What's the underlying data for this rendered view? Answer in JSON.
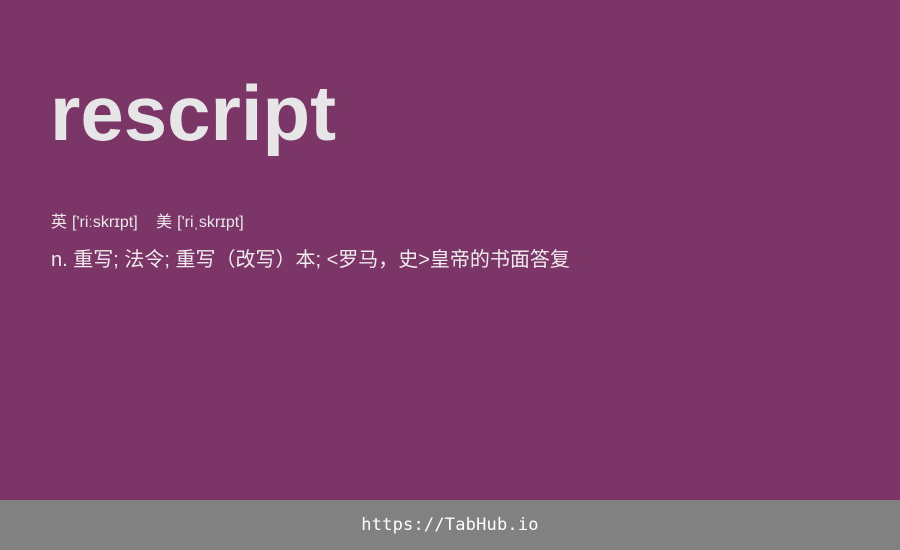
{
  "entry": {
    "word": "rescript",
    "phonetics": [
      {
        "region": "英",
        "ipa": "['riːskrɪpt]"
      },
      {
        "region": "美",
        "ipa": "['riˌskrɪpt]"
      }
    ],
    "definition": "n. 重写; 法令; 重写（改写）本; <罗马，史>皇帝的书面答复"
  },
  "footer": {
    "link_text": "https://TabHub.io"
  },
  "colors": {
    "background": "#7b3566",
    "text": "#e6e6e6",
    "footer_background": "#818181",
    "footer_text": "#ffffff"
  }
}
